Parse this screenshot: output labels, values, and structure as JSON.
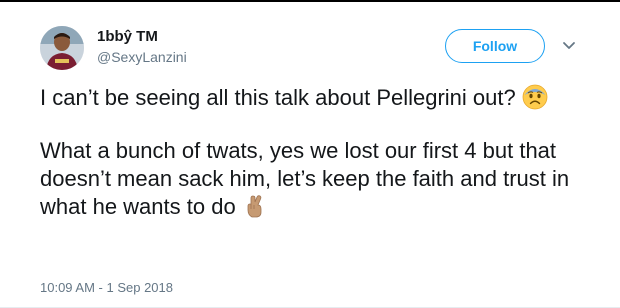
{
  "author": {
    "display_name": "1bbŷ TM",
    "handle": "@SexyLanzini"
  },
  "actions": {
    "follow_label": "Follow"
  },
  "tweet": {
    "line1": "I can’t be seeing all this talk about Pellegrini out?",
    "line2": "What a bunch of twats, yes we lost our first 4 but that doesn’t mean sack him, let’s keep the faith and trust in what he wants to do",
    "emoji1": "fearful-face-icon",
    "emoji2": "crossed-fingers-icon"
  },
  "meta": {
    "timestamp": "10:09 AM - 1 Sep 2018"
  },
  "colors": {
    "accent": "#1da1f2",
    "text": "#14171a",
    "muted": "#657786"
  }
}
